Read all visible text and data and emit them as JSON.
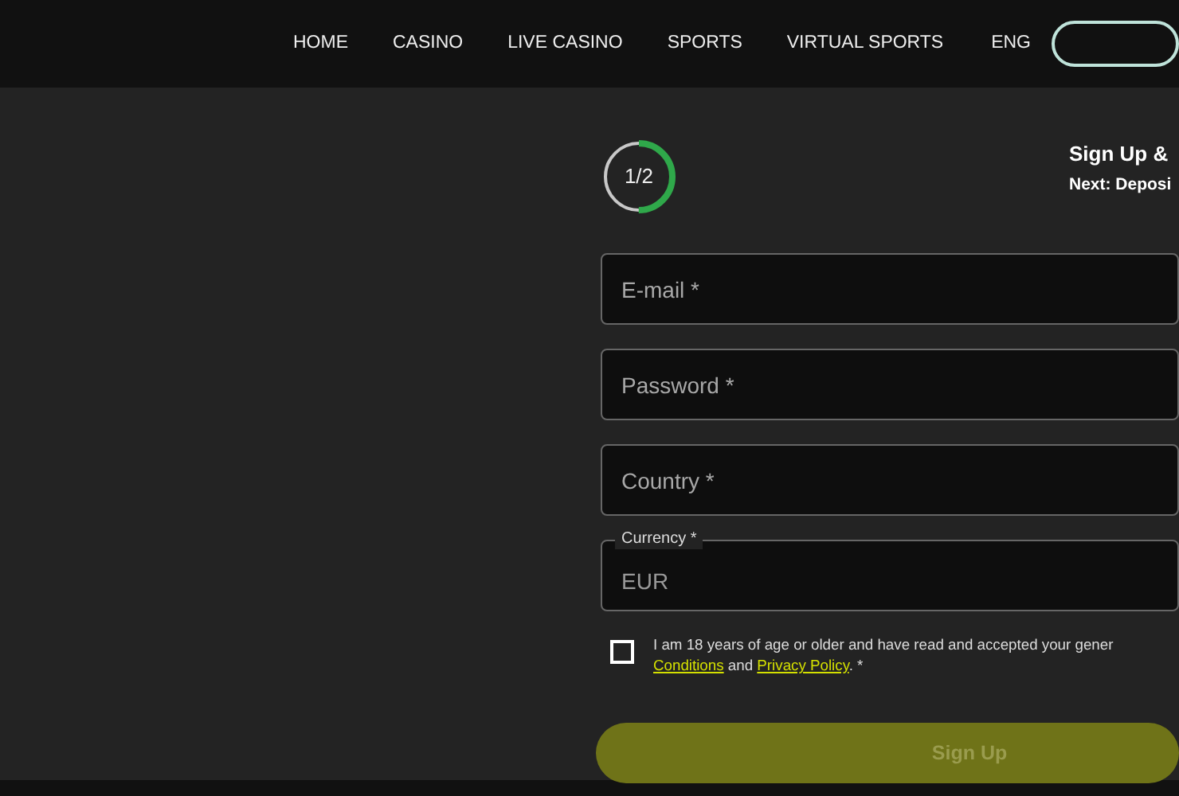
{
  "nav": {
    "items": [
      {
        "label": "HOME"
      },
      {
        "label": "CASINO"
      },
      {
        "label": "LIVE CASINO"
      },
      {
        "label": "SPORTS"
      },
      {
        "label": "VIRTUAL SPORTS"
      }
    ],
    "language": "ENG"
  },
  "progress": {
    "text": "1/2",
    "level": 0.5
  },
  "step": {
    "title": "Sign Up &",
    "next": "Next: Deposi"
  },
  "fields": [
    {
      "placeholder": "E-mail *"
    },
    {
      "placeholder": "Password *"
    },
    {
      "placeholder": "Country *"
    },
    {
      "label": "Currency *",
      "value": "EUR"
    }
  ],
  "consent": {
    "checked": false,
    "text": "I am 18 years of age or older and have read and accepted your gener",
    "link_1": "Conditions",
    "middle": " and ",
    "link_2": "Privacy Policy",
    "after": ". *"
  },
  "submit": {
    "label": "Sign Up",
    "disabled": true
  }
}
